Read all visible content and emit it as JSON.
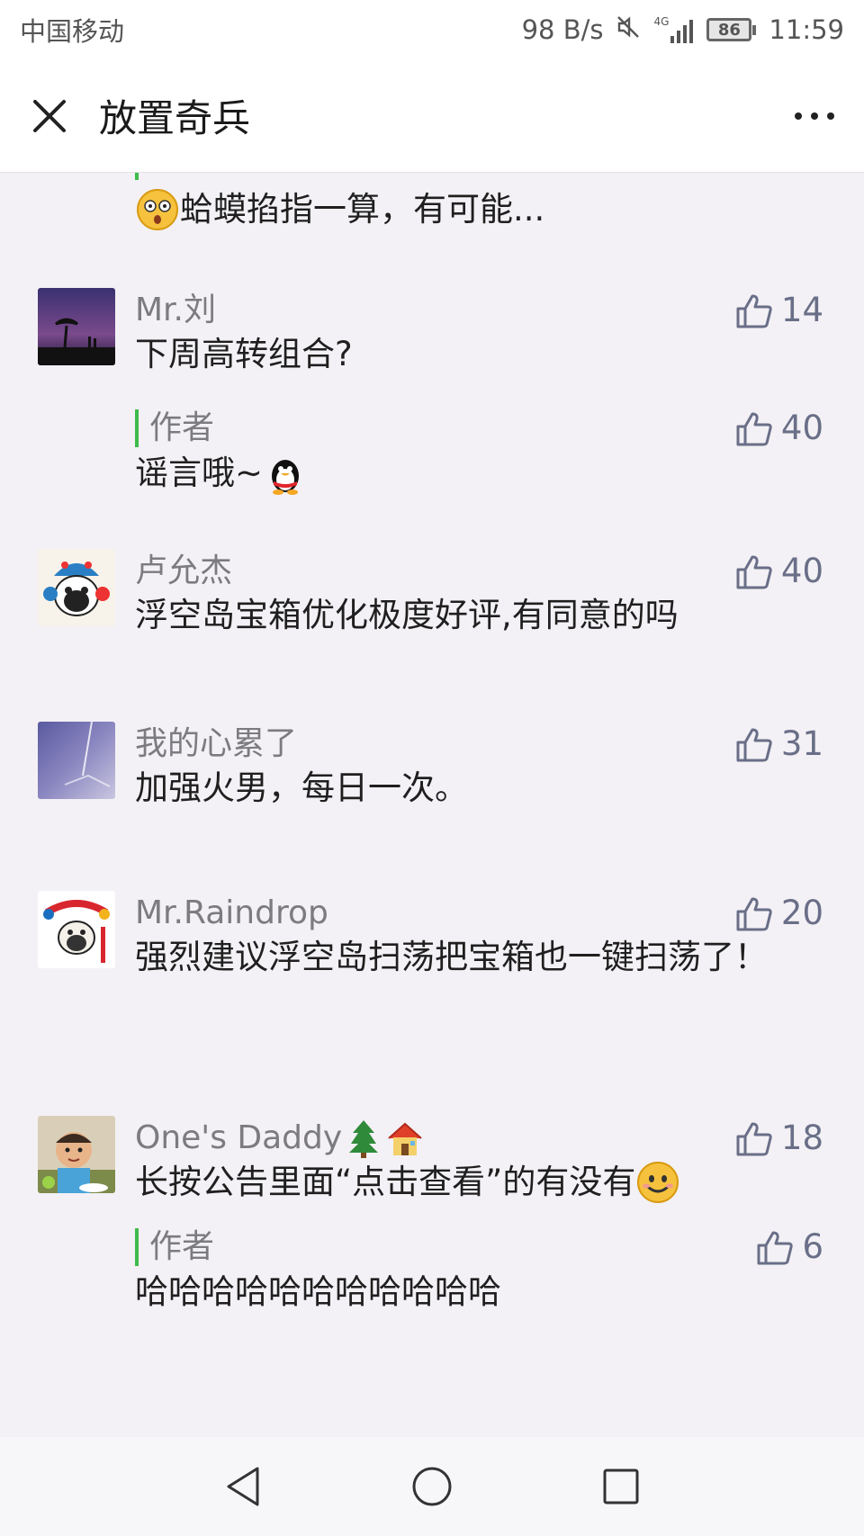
{
  "status_bar": {
    "carrier": "中国移动",
    "speed": "98 B/s",
    "network": "4G",
    "battery": "86",
    "time": "11:59"
  },
  "header": {
    "title": "放置奇兵"
  },
  "partial_reply": {
    "text": "蛤蟆掐指一算，有可能..."
  },
  "comments": [
    {
      "name": "Mr.刘",
      "text": "下周高转组合?",
      "likes": "14",
      "reply": {
        "label": "作者",
        "likes": "40",
        "text": "谣言哦~"
      }
    },
    {
      "name": "卢允杰",
      "text": "浮空岛宝箱优化极度好评,有同意的吗",
      "likes": "40"
    },
    {
      "name": "我的心累了",
      "text": "加强火男，每日一次。",
      "likes": "31"
    },
    {
      "name": "Mr.Raindrop",
      "text": "强烈建议浮空岛扫荡把宝箱也一键扫荡了！",
      "likes": "20"
    },
    {
      "name": "One's Daddy",
      "text": "长按公告里面“点击查看”的有没有",
      "likes": "18",
      "reply": {
        "label": "作者",
        "likes": "6",
        "text": "哈哈哈哈哈哈哈哈哈哈哈"
      }
    }
  ],
  "colors": {
    "accent_bar": "#3dbb4b",
    "like_icon": "#6a6f88",
    "name_text": "#7b7b80"
  }
}
